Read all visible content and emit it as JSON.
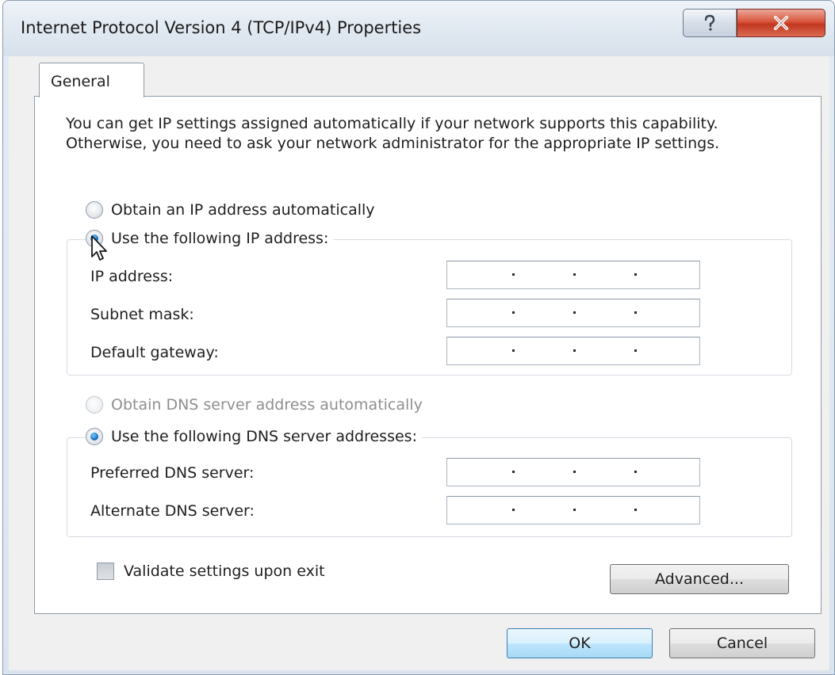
{
  "window": {
    "title": "Internet Protocol Version 4 (TCP/IPv4) Properties",
    "help_symbol": "?",
    "close_symbol": "X"
  },
  "tabs": [
    {
      "label": "General",
      "selected": true
    }
  ],
  "intro_text": "You can get IP settings assigned automatically if your network supports this capability. Otherwise, you need to ask your network administrator for the appropriate IP settings.",
  "ip_section": {
    "auto_option": {
      "label": "Obtain an IP address automatically",
      "checked": false
    },
    "manual_option": {
      "label": "Use the following IP address:",
      "checked": true
    },
    "fields": [
      {
        "label": "IP address:",
        "value": ""
      },
      {
        "label": "Subnet mask:",
        "value": ""
      },
      {
        "label": "Default gateway:",
        "value": ""
      }
    ]
  },
  "dns_section": {
    "auto_option": {
      "label": "Obtain DNS server address automatically",
      "checked": false,
      "disabled": true
    },
    "manual_option": {
      "label": "Use the following DNS server addresses:",
      "checked": true
    },
    "fields": [
      {
        "label": "Preferred DNS server:",
        "value": ""
      },
      {
        "label": "Alternate DNS server:",
        "value": ""
      }
    ]
  },
  "validate_checkbox": {
    "label": "Validate settings upon exit",
    "checked": false
  },
  "buttons": {
    "advanced": "Advanced...",
    "ok": "OK",
    "cancel": "Cancel"
  }
}
